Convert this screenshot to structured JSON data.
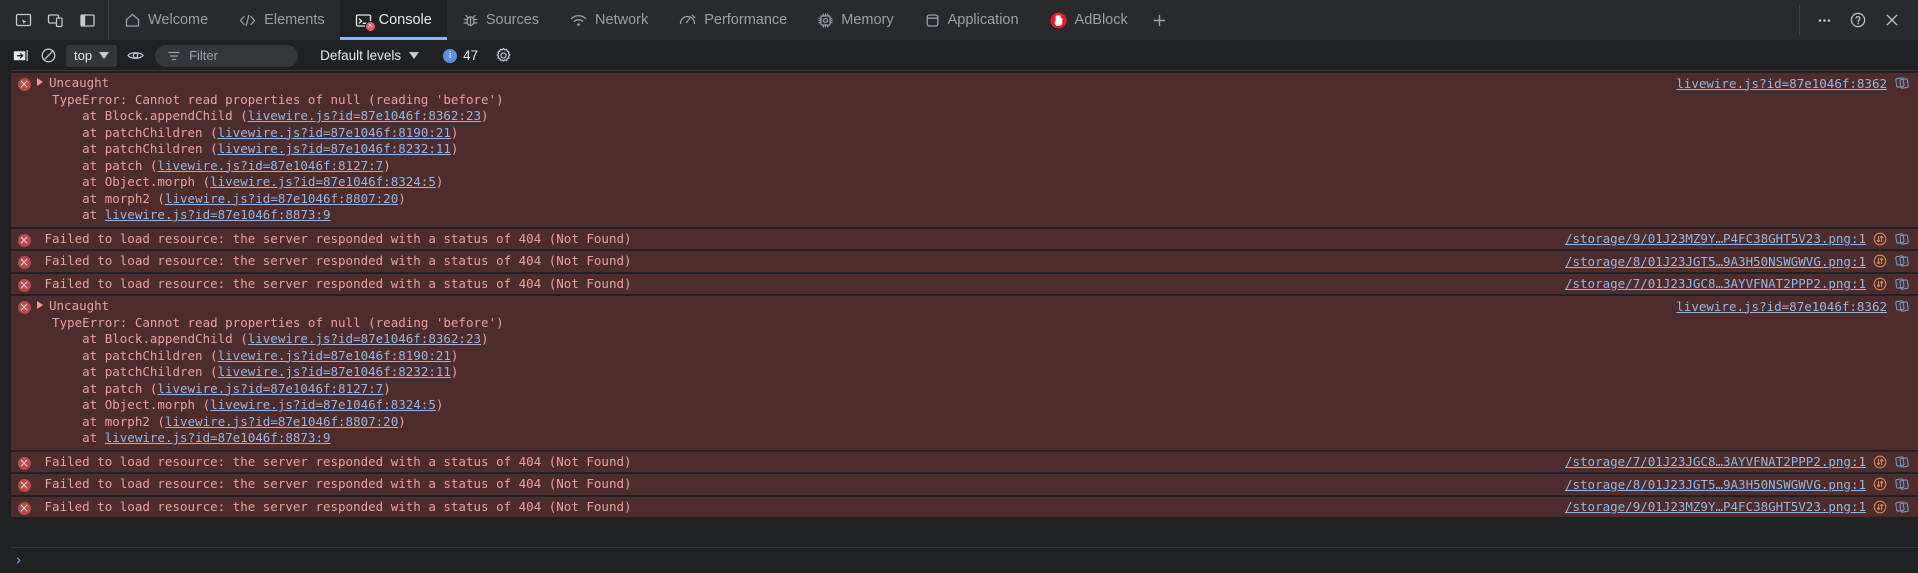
{
  "window": {
    "right_controls": [
      {
        "name": "more-options",
        "glyph": "⋯"
      },
      {
        "name": "help",
        "glyph": "?"
      },
      {
        "name": "close",
        "glyph": "×"
      }
    ]
  },
  "tabbar": {
    "dock_buttons": [
      "inspect-element",
      "device-toolbar",
      "dock-side"
    ],
    "tabs": [
      {
        "label": "Welcome",
        "icon": "home-icon",
        "active": false,
        "error_badge": false
      },
      {
        "label": "Elements",
        "icon": "code-icon",
        "active": false,
        "error_badge": false
      },
      {
        "label": "Console",
        "icon": "console-icon",
        "active": true,
        "error_badge": true
      },
      {
        "label": "Sources",
        "icon": "bug-icon",
        "active": false,
        "error_badge": false
      },
      {
        "label": "Network",
        "icon": "wifi-icon",
        "active": false,
        "error_badge": false
      },
      {
        "label": "Performance",
        "icon": "speedometer-icon",
        "active": false,
        "error_badge": false
      },
      {
        "label": "Memory",
        "icon": "chip-icon",
        "active": false,
        "error_badge": false
      },
      {
        "label": "Application",
        "icon": "database-icon",
        "active": false,
        "error_badge": false
      },
      {
        "label": "AdBlock",
        "icon": "adblock-hand-icon",
        "active": false,
        "error_badge": false
      }
    ],
    "add_tab_label": "+"
  },
  "toolbar": {
    "clear_console_label": "Clear console",
    "no_entry_label": "No entry",
    "context_value": "top",
    "eye_label": "Live expression",
    "filter_placeholder": "Filter",
    "filter_value": "",
    "levels_label": "Default levels",
    "info_count": "47",
    "settings_label": "Console settings"
  },
  "accent_colors": {
    "tab_active_underline": "#8ab4f8",
    "error_background": "#4c2c2c",
    "error_text": "#e9a0a0",
    "link": "#9ab6e0",
    "badge_blue": "#5a8fdb",
    "error_icon": "#b94a4a",
    "prompt": "#6ea8fe"
  },
  "messages": [
    {
      "type": "error-group",
      "expandable": true,
      "header": "Uncaught",
      "lines": [
        {
          "text": "TypeError: Cannot read properties of null (reading 'before')",
          "indent": 0,
          "link": null
        },
        {
          "text": "at Block.appendChild (",
          "indent": 1,
          "link": "livewire.js?id=87e1046f:8362:23",
          "suffix": ")"
        },
        {
          "text": "at patchChildren (",
          "indent": 1,
          "link": "livewire.js?id=87e1046f:8190:21",
          "suffix": ")"
        },
        {
          "text": "at patchChildren (",
          "indent": 1,
          "link": "livewire.js?id=87e1046f:8232:11",
          "suffix": ")"
        },
        {
          "text": "at patch (",
          "indent": 1,
          "link": "livewire.js?id=87e1046f:8127:7",
          "suffix": ")"
        },
        {
          "text": "at Object.morph (",
          "indent": 1,
          "link": "livewire.js?id=87e1046f:8324:5",
          "suffix": ")"
        },
        {
          "text": "at morph2 (",
          "indent": 1,
          "link": "livewire.js?id=87e1046f:8807:20",
          "suffix": ")"
        },
        {
          "text": "at ",
          "indent": 1,
          "link": "livewire.js?id=87e1046f:8873:9",
          "suffix": ""
        }
      ],
      "source": "livewire.js?id=87e1046f:8362",
      "has_network_icon": false,
      "has_copy_icon": true
    },
    {
      "type": "error",
      "text": "Failed to load resource: the server responded with a status of 404 (Not Found)",
      "source": "/storage/9/01J23MZ9Y…P4FC38GHT5V23.png:1",
      "has_network_icon": true,
      "has_copy_icon": true
    },
    {
      "type": "error",
      "text": "Failed to load resource: the server responded with a status of 404 (Not Found)",
      "source": "/storage/8/01J23JGT5…9A3H50NSWGWVG.png:1",
      "has_network_icon": true,
      "has_copy_icon": true
    },
    {
      "type": "error",
      "text": "Failed to load resource: the server responded with a status of 404 (Not Found)",
      "source": "/storage/7/01J23JGC8…3AYVFNAT2PPP2.png:1",
      "has_network_icon": true,
      "has_copy_icon": true
    },
    {
      "type": "error-group",
      "expandable": true,
      "header": "Uncaught",
      "lines": [
        {
          "text": "TypeError: Cannot read properties of null (reading 'before')",
          "indent": 0,
          "link": null
        },
        {
          "text": "at Block.appendChild (",
          "indent": 1,
          "link": "livewire.js?id=87e1046f:8362:23",
          "suffix": ")"
        },
        {
          "text": "at patchChildren (",
          "indent": 1,
          "link": "livewire.js?id=87e1046f:8190:21",
          "suffix": ")"
        },
        {
          "text": "at patchChildren (",
          "indent": 1,
          "link": "livewire.js?id=87e1046f:8232:11",
          "suffix": ")"
        },
        {
          "text": "at patch (",
          "indent": 1,
          "link": "livewire.js?id=87e1046f:8127:7",
          "suffix": ")"
        },
        {
          "text": "at Object.morph (",
          "indent": 1,
          "link": "livewire.js?id=87e1046f:8324:5",
          "suffix": ")"
        },
        {
          "text": "at morph2 (",
          "indent": 1,
          "link": "livewire.js?id=87e1046f:8807:20",
          "suffix": ")"
        },
        {
          "text": "at ",
          "indent": 1,
          "link": "livewire.js?id=87e1046f:8873:9",
          "suffix": ""
        }
      ],
      "source": "livewire.js?id=87e1046f:8362",
      "has_network_icon": false,
      "has_copy_icon": true
    },
    {
      "type": "error",
      "text": "Failed to load resource: the server responded with a status of 404 (Not Found)",
      "source": "/storage/7/01J23JGC8…3AYVFNAT2PPP2.png:1",
      "has_network_icon": true,
      "has_copy_icon": true
    },
    {
      "type": "error",
      "text": "Failed to load resource: the server responded with a status of 404 (Not Found)",
      "source": "/storage/8/01J23JGT5…9A3H50NSWGWVG.png:1",
      "has_network_icon": true,
      "has_copy_icon": true
    },
    {
      "type": "error",
      "text": "Failed to load resource: the server responded with a status of 404 (Not Found)",
      "source": "/storage/9/01J23MZ9Y…P4FC38GHT5V23.png:1",
      "has_network_icon": true,
      "has_copy_icon": true
    }
  ],
  "prompt": {
    "chevron": "›",
    "value": ""
  }
}
